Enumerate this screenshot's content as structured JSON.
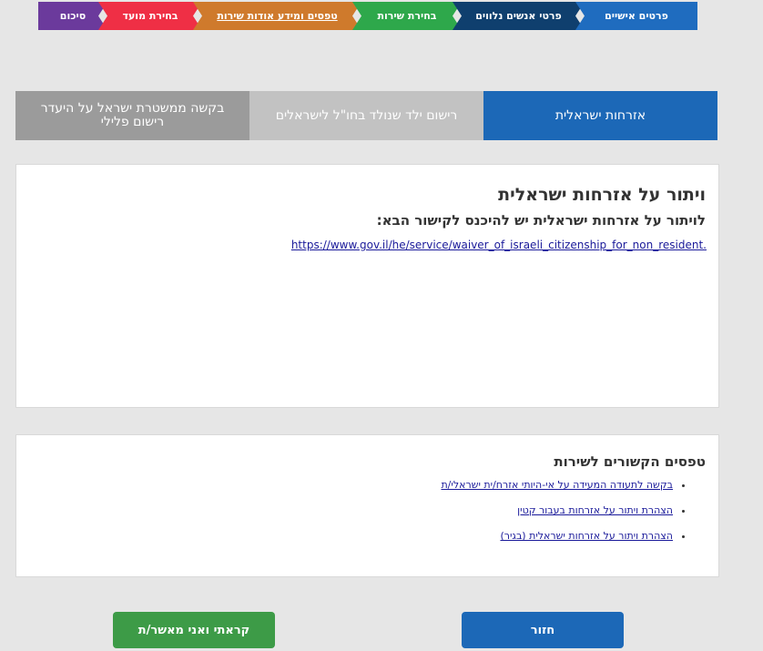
{
  "steps": [
    {
      "label": "פרטים אישיים",
      "color": "#1f6cbf"
    },
    {
      "label": "פרטי אנשים נלווים",
      "color": "#0f3f6e"
    },
    {
      "label": "בחירת שירות",
      "color": "#2ea84b"
    },
    {
      "label": "טפסים ומידע אודות שירות",
      "color": "#cf7a2c"
    },
    {
      "label": "בחירת מועד",
      "color": "#ef2f45"
    },
    {
      "label": "סיכום",
      "color": "#6b3a9c"
    }
  ],
  "tabs": [
    {
      "label": "אזרחות ישראלית",
      "active": true
    },
    {
      "label": "רישום ילד שנולד בחו\"ל לישראלים",
      "active": false
    },
    {
      "label": "בקשה ממשטרת ישראל על היעדר רישום פלילי",
      "active": false
    }
  ],
  "main": {
    "title": "ויתור על אזרחות ישראלית",
    "subtitle": "לויתור על אזרחות ישראלית יש להיכנס לקישור הבא:",
    "link": "https://www.gov.il/he/service/waiver_of_israeli_citizenship_for_non_resident."
  },
  "tips": {
    "title": "טפסים הקשורים לשירות",
    "items": [
      "בקשה לתעודה המעידה על אי-היותי אזרח/ית ישראלי/ת",
      "הצהרת ויתור על אזרחות בעבור קטין",
      "הצהרת ויתור על אזרחות ישראלית (בגיר)"
    ]
  },
  "buttons": {
    "back": "חזור",
    "confirm": "קראתי ואני מאשר/ת"
  },
  "colors": {
    "primary": "#1c68b7",
    "confirm": "#3d9b47",
    "link": "#1a1a9a"
  }
}
